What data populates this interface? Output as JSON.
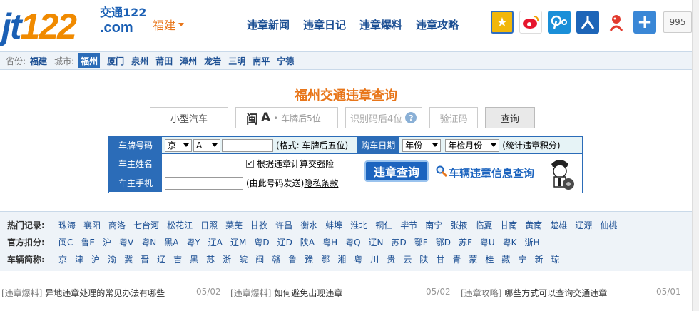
{
  "logo": {
    "main_jt": "jt",
    "main_num": "122",
    "cn": "交通122",
    "com": ".com"
  },
  "province_select": {
    "value": "福建"
  },
  "nav": [
    "违章新闻",
    "违章日记",
    "违章爆料",
    "违章攻略"
  ],
  "share": {
    "count": "995"
  },
  "citybar": {
    "province_label": "省份:",
    "province": "福建",
    "city_label": "城市:",
    "active": "福州",
    "cities": [
      "厦门",
      "泉州",
      "莆田",
      "漳州",
      "龙岩",
      "三明",
      "南平",
      "宁德"
    ]
  },
  "query": {
    "title": "福州交通违章查询",
    "car_type": "小型汽车",
    "plate_prefix": "闽",
    "plate_letter": "A",
    "plate_placeholder": "• 车牌后5位",
    "code_placeholder": "识别码后4位",
    "captcha_placeholder": "验证码",
    "button": "查询"
  },
  "form": {
    "plate_label": "车牌号码",
    "plate_prov": "京",
    "plate_letter": "A",
    "plate_note": "(格式: 车牌后五位)",
    "buy_date_label": "购车日期",
    "year_select": "年份",
    "month_select": "年检月份",
    "stat_note": "(统计违章积分)",
    "owner_label": "车主姓名",
    "insurance_note": "根据违章计算交强险",
    "phone_label": "车主手机",
    "phone_note": "(由此号码发送)",
    "privacy": "隐私条款",
    "submit": "违章查询",
    "info_link": "车辆违章信息查询"
  },
  "lists": {
    "hot": {
      "label": "热门记录:",
      "items": [
        "珠海",
        "襄阳",
        "商洛",
        "七台河",
        "松花江",
        "日照",
        "莱芜",
        "甘孜",
        "许昌",
        "衡水",
        "蚌埠",
        "淮北",
        "铜仁",
        "毕节",
        "南宁",
        "张掖",
        "临夏",
        "甘南",
        "黄南",
        "楚雄",
        "辽源",
        "仙桃"
      ]
    },
    "official": {
      "label": "官方扣分:",
      "items": [
        "闽C",
        "鲁E",
        "沪",
        "粤V",
        "粤N",
        "黑A",
        "粤Y",
        "辽A",
        "辽M",
        "粤D",
        "辽D",
        "陕A",
        "粤H",
        "粤Q",
        "辽N",
        "苏D",
        "鄂F",
        "鄂D",
        "苏F",
        "粤U",
        "粤K",
        "浙H"
      ]
    },
    "abbr": {
      "label": "车辆简称:",
      "items": [
        "京",
        "津",
        "沪",
        "渝",
        "冀",
        "晋",
        "辽",
        "吉",
        "黑",
        "苏",
        "浙",
        "皖",
        "闽",
        "赣",
        "鲁",
        "豫",
        "鄂",
        "湘",
        "粤",
        "川",
        "贵",
        "云",
        "陕",
        "甘",
        "青",
        "蒙",
        "桂",
        "藏",
        "宁",
        "新",
        "琼"
      ]
    }
  },
  "news": [
    {
      "cat": "[违章爆料]",
      "title": "异地违章处理的常见办法有哪些",
      "date": "05/02"
    },
    {
      "cat": "[违章爆料]",
      "title": "如何避免出现违章",
      "date": "05/02"
    },
    {
      "cat": "[违章攻略]",
      "title": "哪些方式可以查询交通违章",
      "date": "05/01"
    }
  ]
}
